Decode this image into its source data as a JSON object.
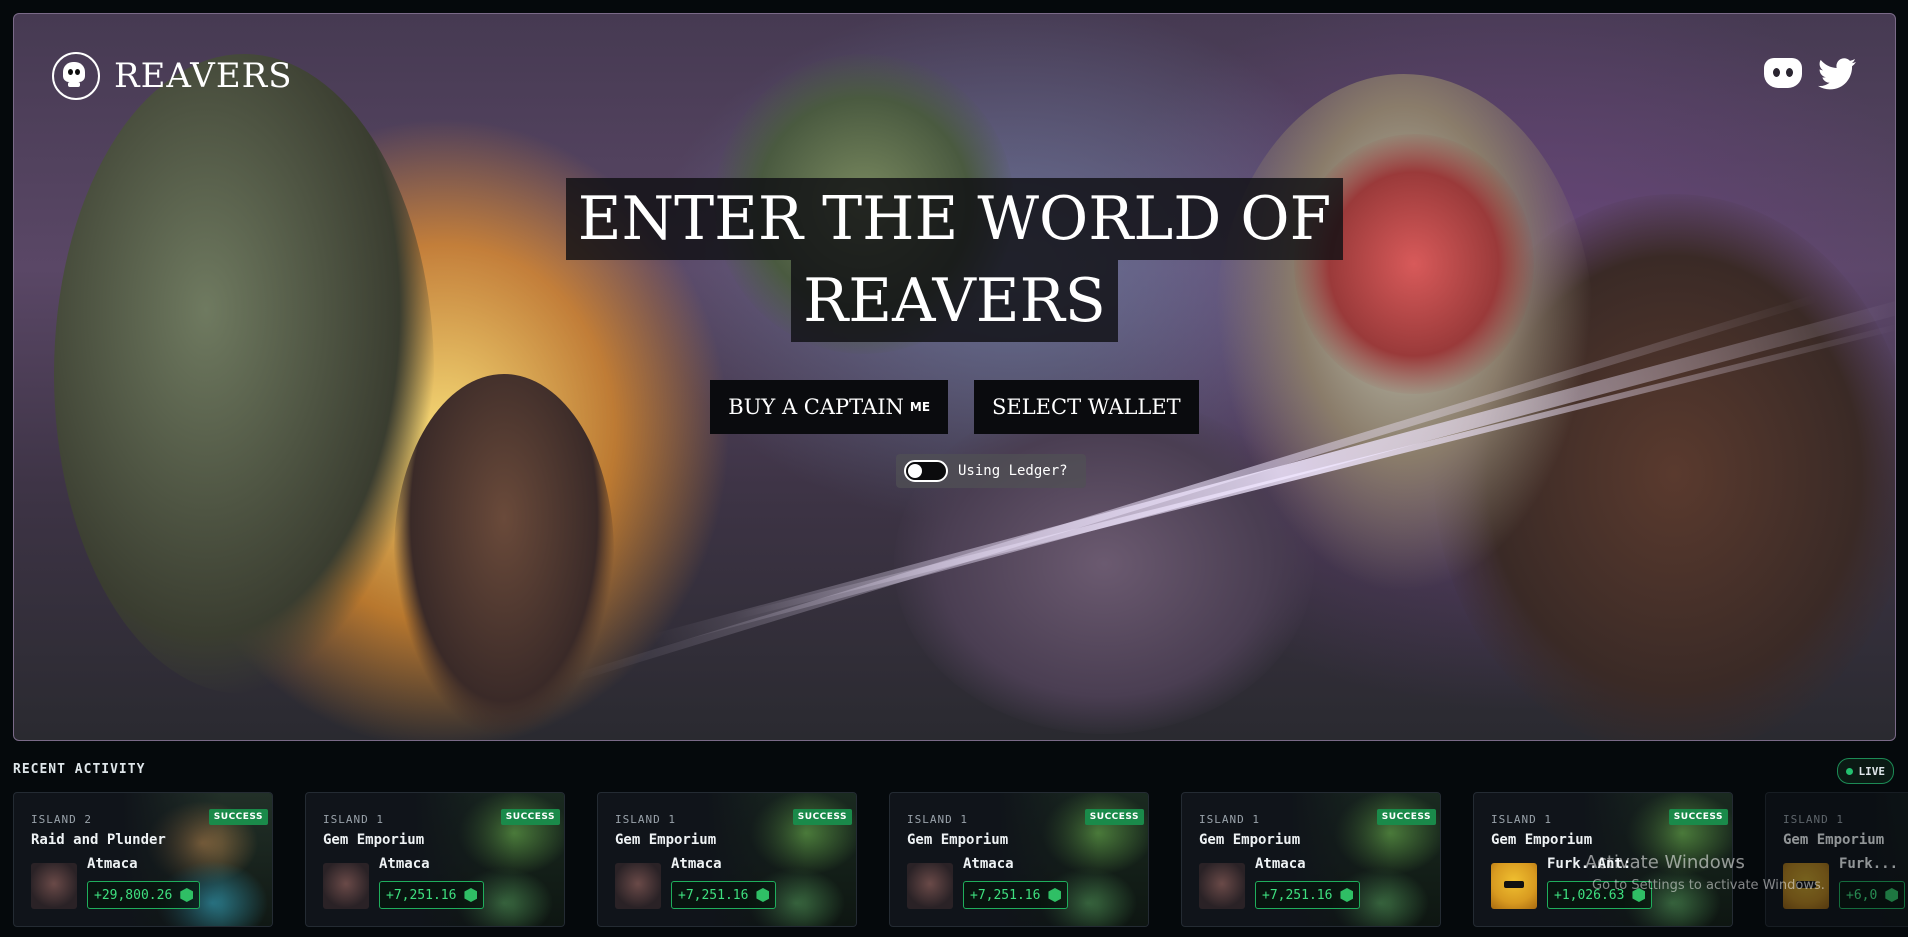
{
  "header": {
    "brand_name": "REAVERS",
    "logo_icon": "skull-logo-icon",
    "social_icons": [
      "discord-icon",
      "twitter-icon"
    ]
  },
  "hero": {
    "headline_line1": "ENTER THE WORLD OF",
    "headline_line2": "REAVERS",
    "buy_button_label": "BUY A CAPTAIN",
    "buy_button_mark": "ME",
    "select_wallet_label": "SELECT WALLET",
    "ledger_toggle_label": "Using Ledger?",
    "ledger_toggle_on": false
  },
  "activity": {
    "title": "RECENT ACTIVITY",
    "live_label": "LIVE",
    "items": [
      {
        "island": "ISLAND 2",
        "action": "Raid and Plunder",
        "owner": "Atmaca",
        "amount": "+29,800.26",
        "status": "SUCCESS"
      },
      {
        "island": "ISLAND 1",
        "action": "Gem Emporium",
        "owner": "Atmaca",
        "amount": "+7,251.16",
        "status": "SUCCESS"
      },
      {
        "island": "ISLAND 1",
        "action": "Gem Emporium",
        "owner": "Atmaca",
        "amount": "+7,251.16",
        "status": "SUCCESS"
      },
      {
        "island": "ISLAND 1",
        "action": "Gem Emporium",
        "owner": "Atmaca",
        "amount": "+7,251.16",
        "status": "SUCCESS"
      },
      {
        "island": "ISLAND 1",
        "action": "Gem Emporium",
        "owner": "Atmaca",
        "amount": "+7,251.16",
        "status": "SUCCESS"
      },
      {
        "island": "ISLAND 1",
        "action": "Gem Emporium",
        "owner": "Furk..Ant:",
        "amount": "+1,026.63",
        "status": "SUCCESS"
      },
      {
        "island": "ISLAND 1",
        "action": "Gem Emporium",
        "owner": "Furk...",
        "amount": "+6,0",
        "status": ""
      }
    ]
  },
  "watermark": {
    "line1": "Activate Windows",
    "line2": "Go to Settings to activate Windows."
  },
  "colors": {
    "success_green": "#1a8a4a",
    "amount_green": "#3ee07f",
    "background": "#05090c"
  }
}
